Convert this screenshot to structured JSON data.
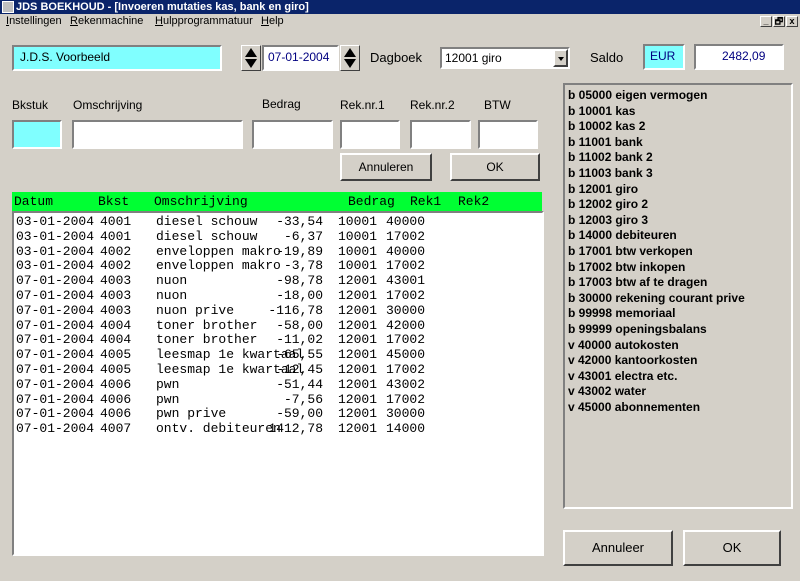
{
  "window": {
    "title": "JDS BOEKHOUD - [Invoeren mutaties kas, bank en giro]",
    "controls": [
      "_",
      "🗗",
      "x"
    ]
  },
  "menu": [
    "Instellingen",
    "Rekenmachine",
    "Hulpprogrammatuur",
    "Help"
  ],
  "header": {
    "company": "J.D.S. Voorbeeld",
    "date": "07-01-2004",
    "dagboek_label": "Dagboek",
    "dagboek_value": "12001 giro",
    "saldo_label": "Saldo",
    "currency": "EUR",
    "saldo_value": "2482,09"
  },
  "entry": {
    "labels": {
      "bkstuk": "Bkstuk",
      "omschrijving": "Omschrijving",
      "bedrag": "Bedrag",
      "rek1": "Rek.nr.1",
      "rek2": "Rek.nr.2",
      "btw": "BTW"
    },
    "values": {
      "bkstuk": "",
      "omschrijving": "",
      "bedrag": "",
      "rek1": "",
      "rek2": "",
      "btw": ""
    },
    "annuleren": "Annuleren",
    "ok": "OK"
  },
  "grid": {
    "columns": [
      "Datum",
      "Bkst",
      "Omschrijving",
      "Bedrag",
      "Rek1",
      "Rek2"
    ],
    "rows": [
      [
        "03-01-2004",
        "4001",
        "diesel schouw",
        "-33,54",
        "10001",
        "40000"
      ],
      [
        "03-01-2004",
        "4001",
        "diesel schouw",
        "-6,37",
        "10001",
        "17002"
      ],
      [
        "03-01-2004",
        "4002",
        "enveloppen makro",
        "-19,89",
        "10001",
        "40000"
      ],
      [
        "03-01-2004",
        "4002",
        "enveloppen makro",
        "-3,78",
        "10001",
        "17002"
      ],
      [
        "07-01-2004",
        "4003",
        "nuon",
        "-98,78",
        "12001",
        "43001"
      ],
      [
        "07-01-2004",
        "4003",
        "nuon",
        "-18,00",
        "12001",
        "17002"
      ],
      [
        "07-01-2004",
        "4003",
        "nuon prive",
        "-116,78",
        "12001",
        "30000"
      ],
      [
        "07-01-2004",
        "4004",
        "toner brother",
        "-58,00",
        "12001",
        "42000"
      ],
      [
        "07-01-2004",
        "4004",
        "toner brother",
        "-11,02",
        "12001",
        "17002"
      ],
      [
        "07-01-2004",
        "4005",
        "leesmap 1e kwartaal",
        "-65,55",
        "12001",
        "45000"
      ],
      [
        "07-01-2004",
        "4005",
        "leesmap 1e kwartaal",
        "-12,45",
        "12001",
        "17002"
      ],
      [
        "07-01-2004",
        "4006",
        "pwn",
        "-51,44",
        "12001",
        "43002"
      ],
      [
        "07-01-2004",
        "4006",
        "pwn",
        "-7,56",
        "12001",
        "17002"
      ],
      [
        "07-01-2004",
        "4006",
        "pwn prive",
        "-59,00",
        "12001",
        "30000"
      ],
      [
        "07-01-2004",
        "4007",
        "ontv. debiteuren",
        "1412,78",
        "12001",
        "14000"
      ]
    ]
  },
  "accounts": [
    "b 05000 eigen vermogen",
    "b 10001 kas",
    "b 10002 kas 2",
    "b 11001 bank",
    "b 11002 bank 2",
    "b 11003 bank 3",
    "b 12001 giro",
    "b 12002 giro 2",
    "b 12003 giro 3",
    "b 14000 debiteuren",
    "b 17001 btw verkopen",
    "b 17002 btw inkopen",
    "b 17003 btw af te dragen",
    "b 30000 rekening courant prive",
    "b 99998 memoriaal",
    "b 99999 openingsbalans",
    "v 40000 autokosten",
    "v 42000 kantoorkosten",
    "v 43001 electra etc.",
    "v 43002 water",
    "v 45000 abonnementen"
  ],
  "footer": {
    "annuleer": "Annuleer",
    "ok": "OK"
  },
  "colors": {
    "title_bar": "#0a246a",
    "cyan_field": "#80ffff",
    "grid_header": "#00ff33",
    "date_text": "#000080"
  }
}
